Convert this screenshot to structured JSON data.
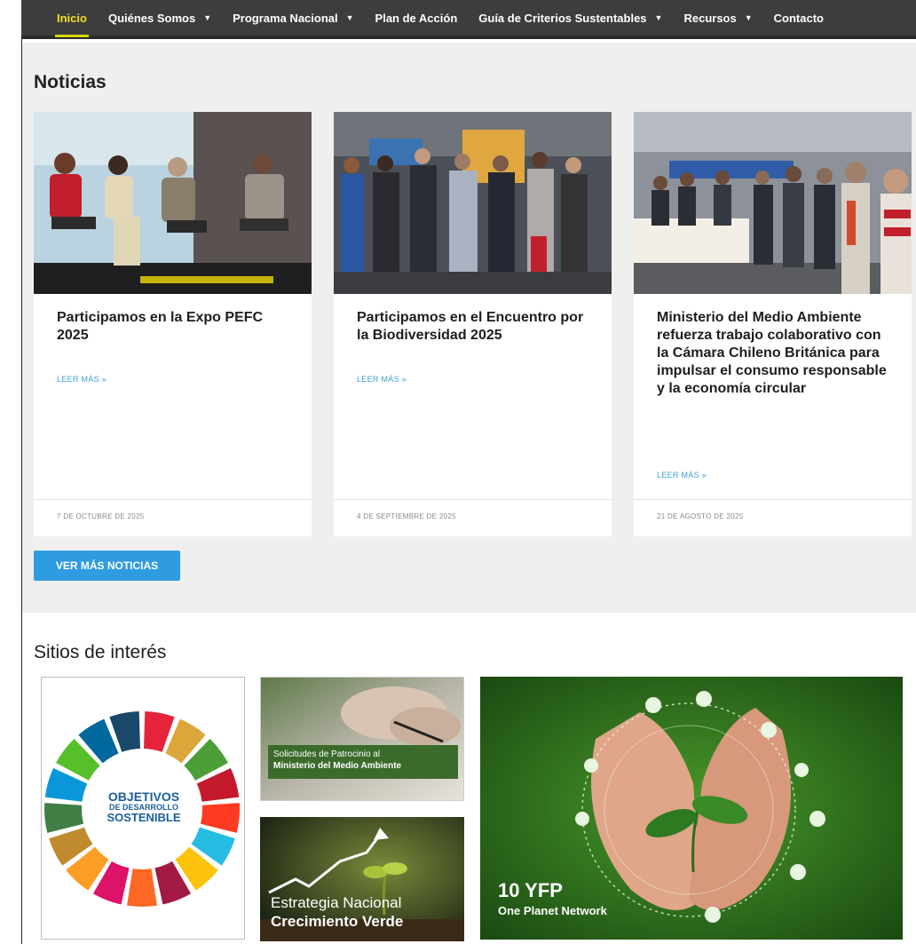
{
  "nav": {
    "items": [
      {
        "label": "Inicio",
        "active": true,
        "dropdown": false
      },
      {
        "label": "Quiénes Somos",
        "active": false,
        "dropdown": true
      },
      {
        "label": "Programa Nacional",
        "active": false,
        "dropdown": true
      },
      {
        "label": "Plan de Acción",
        "active": false,
        "dropdown": false
      },
      {
        "label": "Guía de Criterios Sustentables",
        "active": false,
        "dropdown": true
      },
      {
        "label": "Recursos",
        "active": false,
        "dropdown": true
      },
      {
        "label": "Contacto",
        "active": false,
        "dropdown": false
      }
    ]
  },
  "news": {
    "title": "Noticias",
    "cards": [
      {
        "title": "Participamos en la Expo PEFC 2025",
        "more": "LEER MÁS »",
        "date": "7 DE OCTUBRE DE 2025"
      },
      {
        "title": "Participamos en el Encuentro por la Biodiversidad 2025",
        "more": "LEER MÁS »",
        "date": "4 DE SEPTIEMBRE DE 2025"
      },
      {
        "title": "Ministerio del Medio Ambiente refuerza trabajo colaborativo con la Cámara Chileno Británica para impulsar el consumo responsable y la economía circular",
        "more": "LEER MÁS »",
        "date": "21 DE AGOSTO DE 2025"
      }
    ],
    "button": "VER MÁS NOTICIAS"
  },
  "interest": {
    "title": "Sitios de interés",
    "ods": {
      "line1": "OBJETIVOS",
      "line2": "DE DESARROLLO",
      "line3": "SOSTENIBLE"
    },
    "patrocinio": {
      "line1": "Solicitudes de Patrocinio al",
      "line2": "Ministerio del Medio Ambiente"
    },
    "estrategia": {
      "line1": "Estrategia Nacional",
      "line2": "Crecimiento Verde"
    },
    "yfp": {
      "line1": "10 YFP",
      "line2": "One Planet Network"
    }
  },
  "colors": {
    "nav_bg": "#3d3d3d",
    "nav_active": "#f0e020",
    "link": "#3aa0d8",
    "button": "#2f9be0",
    "section_bg": "#efefef"
  }
}
